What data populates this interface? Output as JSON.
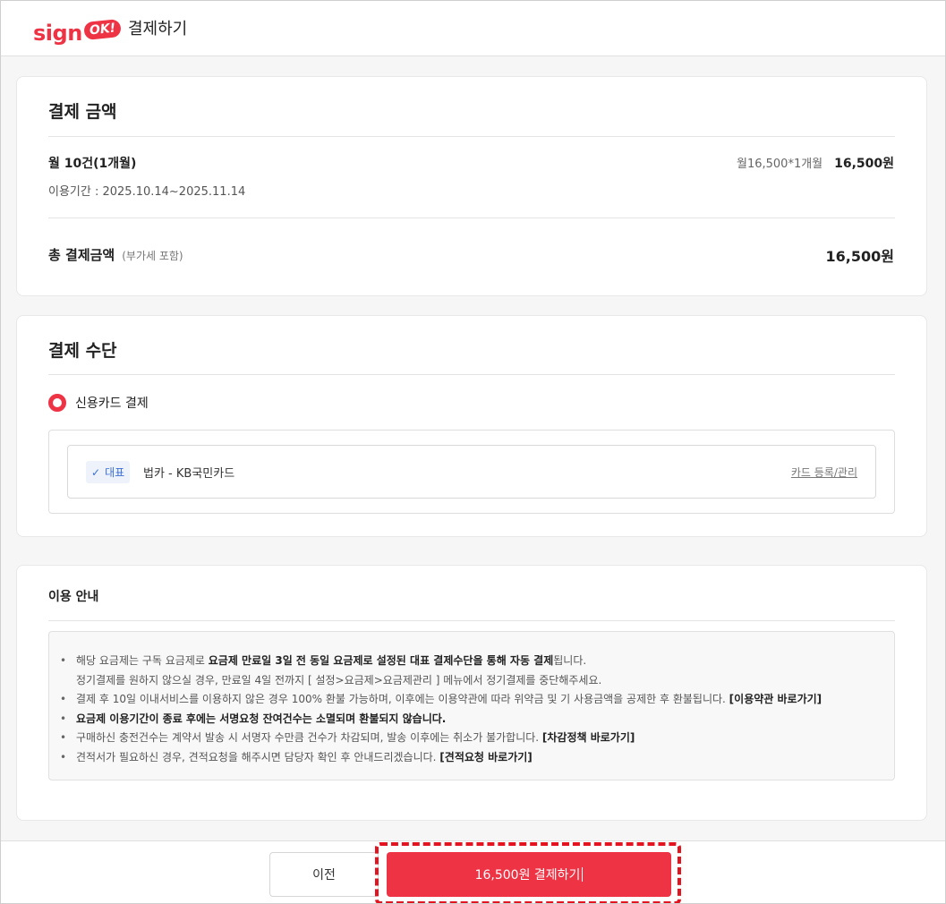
{
  "header": {
    "logo_text": "sign",
    "logo_badge": "OK!",
    "title": "결제하기"
  },
  "payment_amount": {
    "title": "결제 금액",
    "item_name": "월 10건(1개월)",
    "period": "이용기간 : 2025.10.14~2025.11.14",
    "unit_calc": "월16,500*1개월",
    "item_price": "16,500원",
    "total_label": "총 결제금액",
    "total_vat_note": "(부가세 포함)",
    "total_amount": "16,500원"
  },
  "payment_method": {
    "title": "결제 수단",
    "option_label": "신용카드 결제",
    "default_badge": "대표",
    "card_name": "법카 - KB국민카드",
    "manage_link": "카드 등록/관리"
  },
  "usage_guide": {
    "title": "이용 안내",
    "line1_pre": "해당 요금제는 구독 요금제로 ",
    "line1_bold": "요금제 만료일 3일 전 동일 요금제로 설정된 대표 결제수단을 통해 자동 결제",
    "line1_post": "됩니다.",
    "line1b": "정기결제를 원하지 않으실 경우, 만료일 4일 전까지 [ 설정>요금제>요금제관리 ] 메뉴에서 정기결제를 중단해주세요.",
    "line2_pre": "결제 후 10일 이내서비스를 이용하지 않은 경우 100% 환불 가능하며, 이후에는 이용약관에 따라 위약금 및 기 사용금액을 공제한 후 환불됩니다. ",
    "line2_link": "[이용약관 바로가기]",
    "line3_bold": "요금제 이용기간이 종료 후에는 서명요청 잔여건수는 소멸되며 환불되지 않습니다.",
    "line4_pre": "구매하신 충전건수는 계약서 발송 시 서명자 수만큼 건수가 차감되며, 발송 이후에는 취소가 불가합니다. ",
    "line4_link": "[차감정책 바로가기]",
    "line5_pre": "견적서가 필요하신 경우, 견적요청을 해주시면 담당자 확인 후 안내드리겠습니다. ",
    "line5_link": "[견적요청 바로가기]"
  },
  "footer": {
    "prev_label": "이전",
    "pay_label": "16,500원 결제하기"
  },
  "colors": {
    "brand": "#ee3345",
    "highlight": "#e3141f",
    "badge_text": "#3b6fd6",
    "badge_bg": "#eef3fb"
  },
  "icons": {
    "check": "check-icon",
    "radio": "radio-selected-icon"
  }
}
